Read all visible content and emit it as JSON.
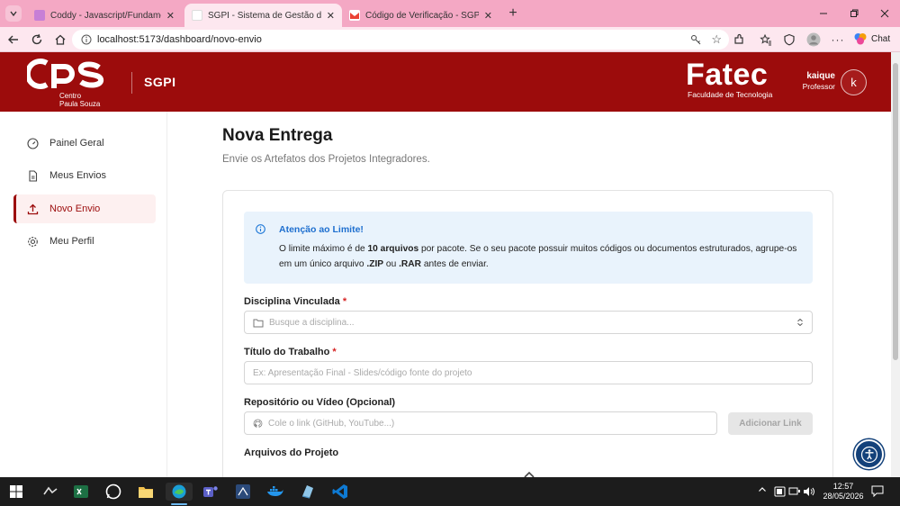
{
  "browser": {
    "tabs": [
      {
        "title": "Coddy - Javascript/Fundamentos",
        "active": false,
        "favicon_color": "#c77fd6"
      },
      {
        "title": "SGPI - Sistema de Gestão de Projet",
        "active": true,
        "favicon_color": "#ffffff"
      },
      {
        "title": "Código de Verificação - SGPI - kaiq",
        "active": false,
        "favicon_color": "#ea4335"
      }
    ],
    "url": "localhost:5173/dashboard/novo-envio",
    "chat_label": "Chat"
  },
  "header": {
    "cps_logo_text": "CPS",
    "cps_sub1": "Centro",
    "cps_sub2": "Paula Souza",
    "app_name": "SGPI",
    "fatec_title": "Fatec",
    "fatec_sub": "Faculdade de Tecnologia",
    "user_name": "kaique",
    "user_role": "Professor",
    "avatar_letter": "k",
    "brand_color": "#9c0c0c"
  },
  "sidebar": {
    "items": [
      {
        "label": "Painel Geral",
        "icon": "gauge-icon",
        "active": false
      },
      {
        "label": "Meus Envios",
        "icon": "document-icon",
        "active": false
      },
      {
        "label": "Novo Envio",
        "icon": "upload-icon",
        "active": true
      },
      {
        "label": "Meu Perfil",
        "icon": "gear-icon",
        "active": false
      }
    ]
  },
  "main": {
    "title": "Nova Entrega",
    "subtitle": "Envie os Artefatos dos Projetos Integradores.",
    "alert": {
      "title": "Atenção ao Limite!",
      "line1_a": "O limite máximo é de ",
      "line1_b": "10 arquivos",
      "line1_c": " por pacote. Se o seu pacote possuir muitos códigos ou documentos estruturados, agrupe-os",
      "line2_a": "em um único arquivo ",
      "line2_b": ".ZIP",
      "line2_c": " ou ",
      "line2_d": ".RAR",
      "line2_e": " antes de enviar."
    },
    "disciplina_label": "Disciplina Vinculada",
    "disciplina_placeholder": "Busque a disciplina...",
    "titulo_label": "Título do Trabalho",
    "titulo_placeholder": "Ex: Apresentação Final - Slides/código fonte do projeto",
    "repo_label": "Repositório ou Vídeo (Opcional)",
    "repo_placeholder": "Cole o link (GitHub, YouTube...)",
    "add_link_label": "Adicionar Link",
    "arquivos_label": "Arquivos do Projeto",
    "required_mark": "*"
  },
  "taskbar": {
    "time": "12:57",
    "date": "28/05/2026"
  }
}
